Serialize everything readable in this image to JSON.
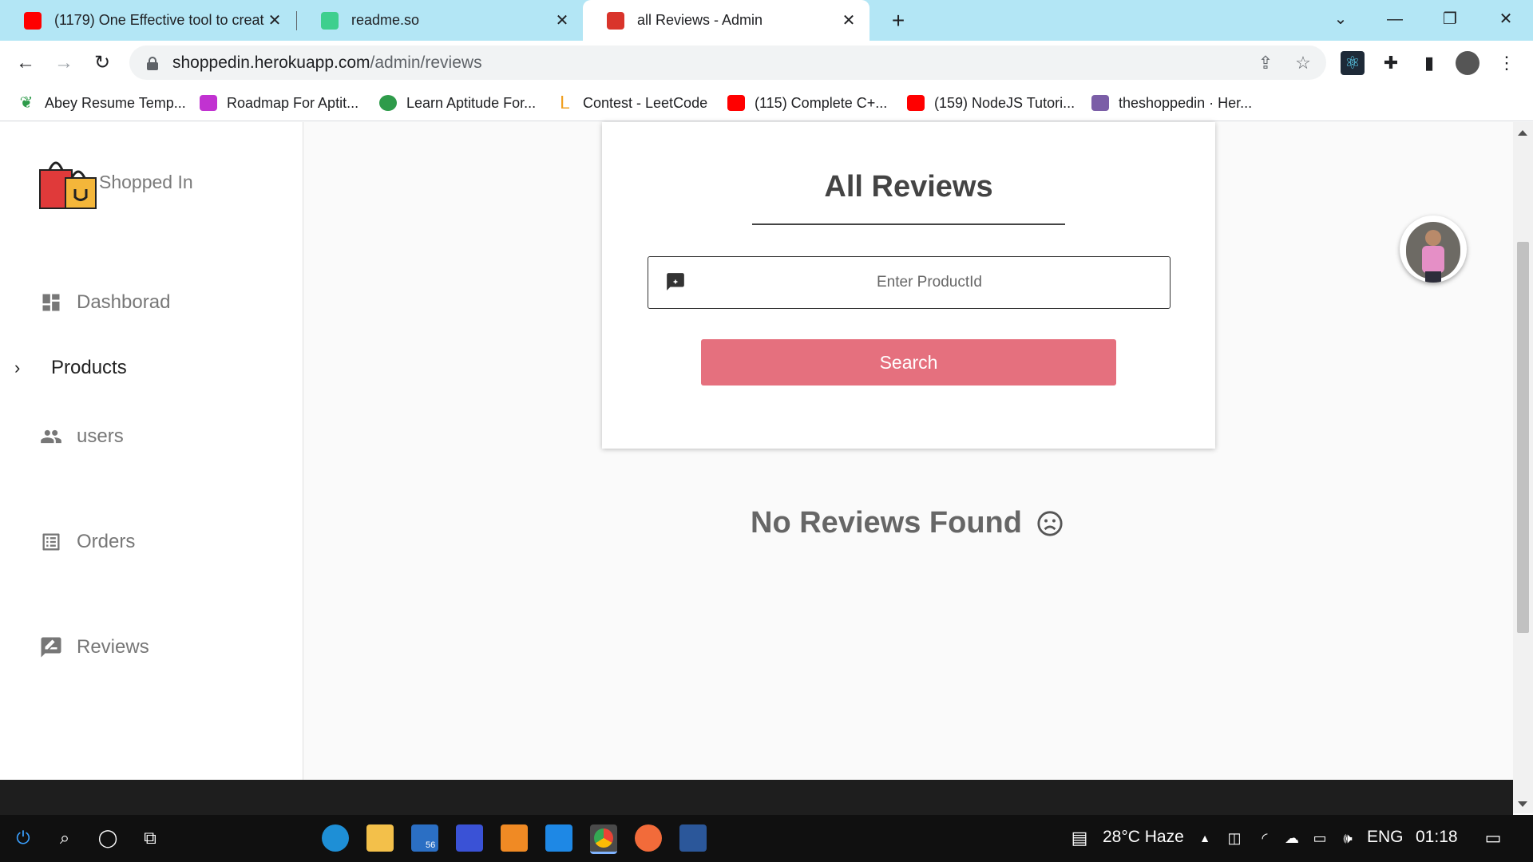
{
  "browser": {
    "tabs": [
      {
        "title": "(1179) One Effective tool to creat",
        "active": false
      },
      {
        "title": "readme.so",
        "active": false
      },
      {
        "title": "all Reviews - Admin",
        "active": true
      }
    ],
    "url_host": "shoppedin.herokuapp.com",
    "url_path": "/admin/reviews",
    "bookmarks": [
      "Abey Resume Temp...",
      "Roadmap For Aptit...",
      "Learn Aptitude For...",
      "Contest - LeetCode",
      "(115) Complete C+...",
      "(159) NodeJS Tutori...",
      "theshoppedin · Her..."
    ]
  },
  "sidebar": {
    "brand": "Shopped In",
    "items": [
      {
        "label": "Dashborad",
        "icon": "dashboard-icon"
      },
      {
        "label": "Products",
        "icon": "chevron-right-icon"
      },
      {
        "label": "users",
        "icon": "people-icon"
      },
      {
        "label": "Orders",
        "icon": "list-alt-icon"
      },
      {
        "label": "Reviews",
        "icon": "rate-review-icon"
      }
    ]
  },
  "main": {
    "title": "All Reviews",
    "search_placeholder": "Enter ProductId",
    "search_button": "Search",
    "empty_message": "No Reviews Found"
  },
  "taskbar": {
    "weather": "28°C  Haze",
    "language": "ENG",
    "time": "01:18",
    "mail_badge": "56"
  },
  "colors": {
    "tabbar": "#b3e6f5",
    "accent_button": "#e5707e",
    "taskbar": "#101010"
  }
}
